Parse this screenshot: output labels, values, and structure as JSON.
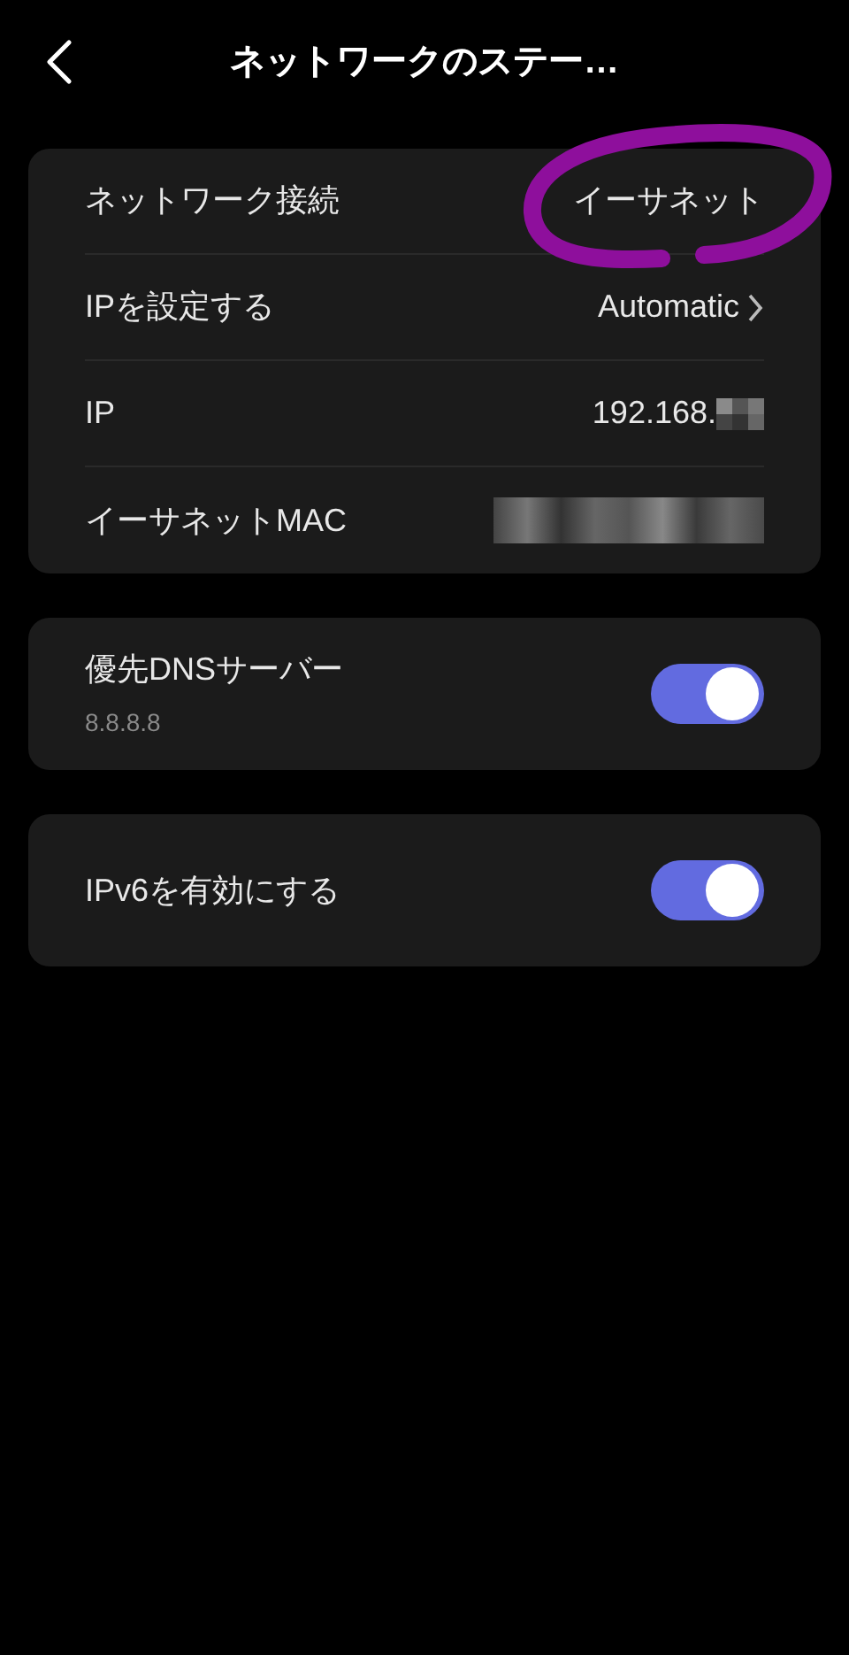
{
  "header": {
    "title": "ネットワークのステー…"
  },
  "info_rows": [
    {
      "kind": "text",
      "label": "ネットワーク接続",
      "value": "イーサネット"
    },
    {
      "kind": "link",
      "label": "IPを設定する",
      "value": "Automatic"
    },
    {
      "kind": "partly_hidden",
      "label": "IP",
      "value": "192.168."
    },
    {
      "kind": "hidden",
      "label": "イーサネットMAC"
    }
  ],
  "toggle_cards": [
    {
      "label": "優先DNSサーバー",
      "sublabel": "8.8.8.8",
      "on": true
    },
    {
      "label": "IPv6を有効にする",
      "on": true
    }
  ]
}
